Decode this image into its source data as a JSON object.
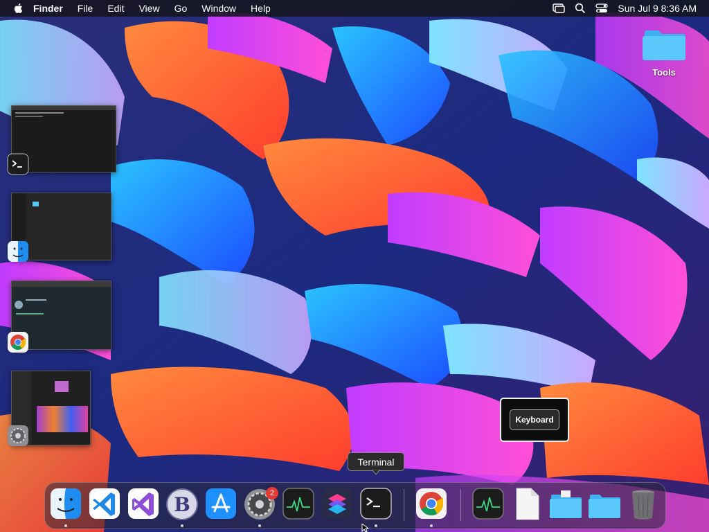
{
  "menubar": {
    "app_name": "Finder",
    "items": [
      "File",
      "Edit",
      "View",
      "Go",
      "Window",
      "Help"
    ],
    "clock": "Sun Jul 9  8:36 AM"
  },
  "desktop": {
    "folder_label": "Tools"
  },
  "switcher": {
    "windows": [
      {
        "app": "Terminal",
        "icon": "terminal-icon"
      },
      {
        "app": "Finder",
        "icon": "finder-icon"
      },
      {
        "app": "Chrome",
        "icon": "chrome-icon"
      },
      {
        "app": "System Settings",
        "icon": "settings-icon"
      }
    ]
  },
  "keyboard_popup": {
    "label": "Keyboard"
  },
  "tooltip": {
    "label": "Terminal"
  },
  "dock": {
    "items": [
      {
        "name": "Finder",
        "icon": "finder-icon",
        "running": true
      },
      {
        "name": "Visual Studio Code",
        "icon": "vscode-icon",
        "running": false
      },
      {
        "name": "Visual Studio",
        "icon": "visual-studio-icon",
        "running": false
      },
      {
        "name": "BBEdit",
        "icon": "bbedit-icon",
        "running": true
      },
      {
        "name": "App Store",
        "icon": "app-store-icon",
        "running": false
      },
      {
        "name": "System Settings",
        "icon": "settings-icon",
        "running": true,
        "badge": "2"
      },
      {
        "name": "Activity Monitor",
        "icon": "activity-monitor-icon",
        "running": false
      },
      {
        "name": "Shortcuts",
        "icon": "shortcuts-icon",
        "running": false
      },
      {
        "name": "Terminal",
        "icon": "terminal-icon",
        "running": true
      },
      {
        "name": "Google Chrome",
        "icon": "chrome-icon",
        "running": true
      },
      {
        "name": "Activity Monitor",
        "icon": "activity-monitor-icon",
        "running": false
      },
      {
        "name": "Document",
        "icon": "document-icon",
        "running": false
      },
      {
        "name": "Downloads",
        "icon": "downloads-folder-icon",
        "running": false
      },
      {
        "name": "Folder",
        "icon": "folder-icon",
        "running": false
      },
      {
        "name": "Trash",
        "icon": "trash-icon",
        "running": false
      }
    ]
  },
  "colors": {
    "accent": "#1e88e5",
    "badge": "#e53935",
    "folder": "#5ac8fa"
  }
}
